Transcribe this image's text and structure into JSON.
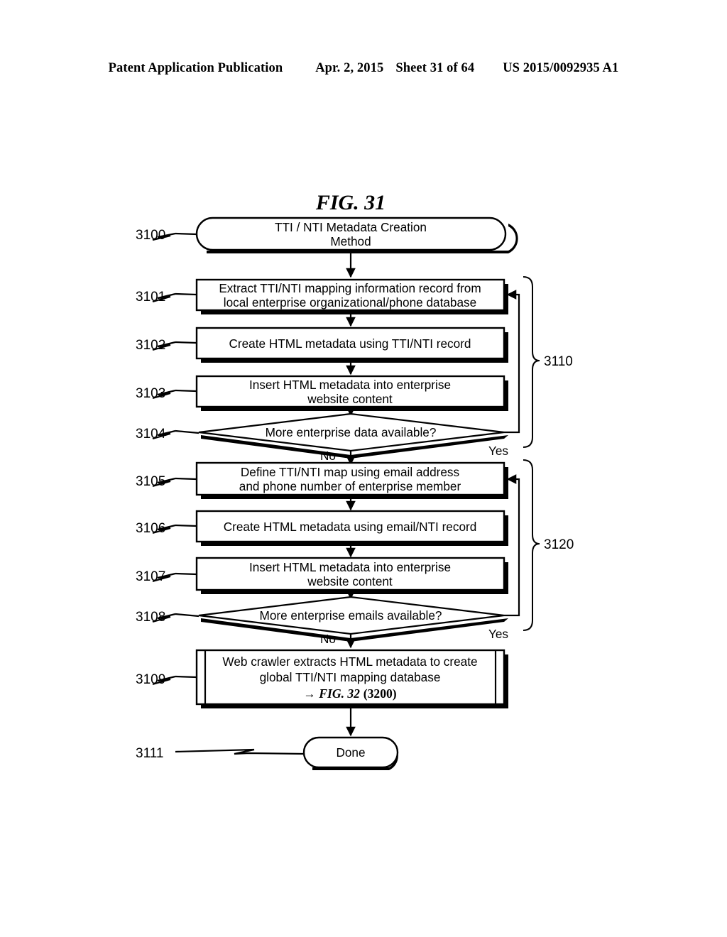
{
  "header": {
    "publication": "Patent Application Publication",
    "date": "Apr. 2, 2015",
    "sheet": "Sheet 31 of 64",
    "patent_number": "US 2015/0092935 A1"
  },
  "figure": {
    "title": "FIG. 31",
    "type": "flowchart"
  },
  "nodes": [
    {
      "ref": "3100",
      "shape": "terminator",
      "lines": [
        "TTI / NTI Metadata Creation",
        "Method"
      ]
    },
    {
      "ref": "3101",
      "shape": "process",
      "lines": [
        "Extract TTI/NTI mapping information record from",
        "local enterprise organizational/phone database"
      ]
    },
    {
      "ref": "3102",
      "shape": "process",
      "lines": [
        "Create HTML metadata using TTI/NTI record"
      ]
    },
    {
      "ref": "3103",
      "shape": "process",
      "lines": [
        "Insert HTML metadata into enterprise",
        "website content"
      ]
    },
    {
      "ref": "3104",
      "shape": "decision",
      "lines": [
        "More enterprise data available?"
      ],
      "branch_no": "No",
      "branch_yes": "Yes"
    },
    {
      "ref": "3105",
      "shape": "process",
      "lines": [
        "Define TTI/NTI map using email address",
        "and phone number of enterprise member"
      ]
    },
    {
      "ref": "3106",
      "shape": "process",
      "lines": [
        "Create HTML metadata using email/NTI record"
      ]
    },
    {
      "ref": "3107",
      "shape": "process",
      "lines": [
        "Insert HTML metadata into enterprise",
        "website content"
      ]
    },
    {
      "ref": "3108",
      "shape": "decision",
      "lines": [
        "More enterprise emails available?"
      ],
      "branch_no": "No",
      "branch_yes": "Yes"
    },
    {
      "ref": "3109",
      "shape": "predefined-process",
      "lines": [
        "Web crawler extracts HTML metadata to create",
        "global TTI/NTI mapping database"
      ],
      "cross_ref_arrow": "→",
      "cross_ref_fig": "FIG. 32",
      "cross_ref_num": "(3200)"
    },
    {
      "ref": "3111",
      "shape": "terminator",
      "lines": [
        "Done"
      ]
    }
  ],
  "groups": [
    {
      "ref": "3110",
      "label": "3110"
    },
    {
      "ref": "3120",
      "label": "3120"
    }
  ],
  "colors": {
    "ink": "#000000",
    "paper": "#ffffff"
  }
}
